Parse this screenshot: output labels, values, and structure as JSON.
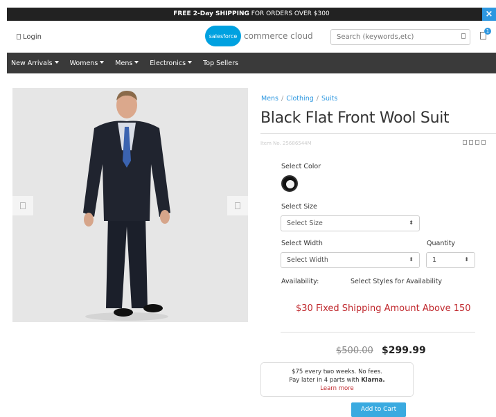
{
  "announcement": {
    "bold": "FREE 2-Day SHIPPING",
    "rest": " FOR ORDERS OVER $300",
    "close_label": "×"
  },
  "header": {
    "login_label": "Login",
    "logo_badge": "salesforce",
    "logo_text": "commerce cloud",
    "search_placeholder": "Search (keywords,etc)",
    "cart_count": "1"
  },
  "nav": {
    "items": [
      {
        "label": "New Arrivals",
        "dropdown": true
      },
      {
        "label": "Womens",
        "dropdown": true
      },
      {
        "label": "Mens",
        "dropdown": true
      },
      {
        "label": "Electronics",
        "dropdown": true
      },
      {
        "label": "Top Sellers",
        "dropdown": false
      }
    ]
  },
  "product": {
    "breadcrumb": [
      "Mens",
      "Clothing",
      "Suits"
    ],
    "title": "Black Flat Front Wool Suit",
    "item_no": "Item No. 25686544M",
    "select_color_label": "Select Color",
    "select_size_label": "Select Size",
    "size_value": "Select Size",
    "select_width_label": "Select Width",
    "width_value": "Select Width",
    "quantity_label": "Quantity",
    "quantity_value": "1",
    "availability_label": "Availability:",
    "availability_value": "Select Styles for Availability",
    "promo": "$30 Fixed Shipping Amount Above 150",
    "price_old": "$500.00",
    "price_new": "$299.99"
  },
  "klarna": {
    "line1": "$75 every two weeks. No fees.",
    "line2_prefix": "Pay later in 4 parts with ",
    "brand": "Klarna.",
    "learn_more": "Learn more"
  },
  "add_to_cart_label": "Add to Cart",
  "colors": {
    "accent": "#2d97e0",
    "promo": "#c0282d",
    "nav_bg": "#3a3a3a"
  }
}
